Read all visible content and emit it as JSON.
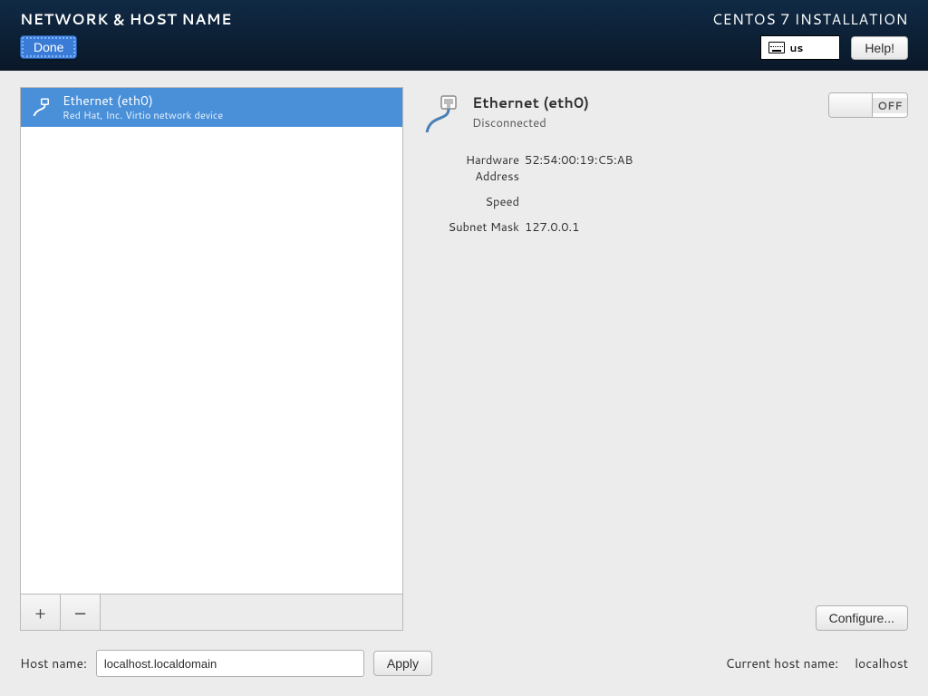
{
  "header": {
    "page_title": "NETWORK & HOST NAME",
    "app_title": "CENTOS 7 INSTALLATION",
    "done_label": "Done",
    "help_label": "Help!",
    "keyboard_layout": "us"
  },
  "device_list": {
    "items": [
      {
        "name": "Ethernet (eth0)",
        "sub": "Red Hat, Inc. Virtio network device"
      }
    ],
    "add_label": "+",
    "remove_label": "−"
  },
  "details": {
    "name": "Ethernet (eth0)",
    "status": "Disconnected",
    "toggle_state_label": "OFF",
    "hw_address_key": "Hardware Address",
    "hw_address_val": "52:54:00:19:C5:AB",
    "speed_key": "Speed",
    "speed_val": "",
    "subnet_mask_key": "Subnet Mask",
    "subnet_mask_val": "127.0.0.1",
    "configure_label": "Configure..."
  },
  "hostname": {
    "label": "Host name:",
    "value": "localhost.localdomain",
    "apply_label": "Apply",
    "current_label": "Current host name:",
    "current_value": "localhost"
  }
}
